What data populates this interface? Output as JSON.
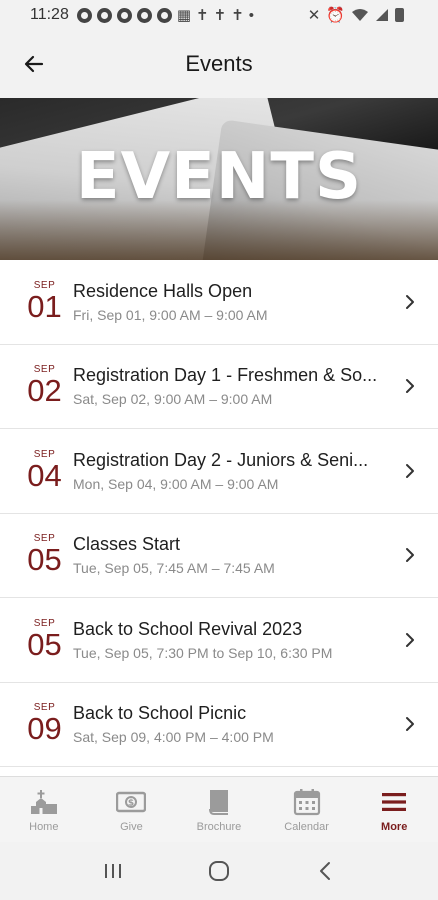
{
  "status_bar": {
    "time": "11:28"
  },
  "app_bar": {
    "title": "Events"
  },
  "hero": {
    "title": "EVENTS"
  },
  "events": [
    {
      "month": "SEP",
      "day": "01",
      "title": "Residence Halls Open",
      "time": "Fri, Sep 01, 9:00 AM – 9:00 AM"
    },
    {
      "month": "SEP",
      "day": "02",
      "title": "Registration Day 1 - Freshmen & So...",
      "time": "Sat, Sep 02, 9:00 AM – 9:00 AM"
    },
    {
      "month": "SEP",
      "day": "04",
      "title": "Registration Day 2 - Juniors & Seni...",
      "time": "Mon, Sep 04, 9:00 AM – 9:00 AM"
    },
    {
      "month": "SEP",
      "day": "05",
      "title": "Classes Start",
      "time": "Tue, Sep 05, 7:45 AM – 7:45 AM"
    },
    {
      "month": "SEP",
      "day": "05",
      "title": "Back to School Revival 2023",
      "time": "Tue, Sep 05, 7:30 PM to Sep 10, 6:30 PM"
    },
    {
      "month": "SEP",
      "day": "09",
      "title": "Back to School Picnic",
      "time": "Sat, Sep 09, 4:00 PM – 4:00 PM"
    }
  ],
  "tabs": [
    {
      "label": "Home",
      "icon": "church-icon"
    },
    {
      "label": "Give",
      "icon": "money-icon"
    },
    {
      "label": "Brochure",
      "icon": "book-icon"
    },
    {
      "label": "Calendar",
      "icon": "calendar-icon"
    },
    {
      "label": "More",
      "icon": "menu-icon"
    }
  ],
  "colors": {
    "accent": "#7a1d1d",
    "inactive": "#9b9b9b"
  }
}
